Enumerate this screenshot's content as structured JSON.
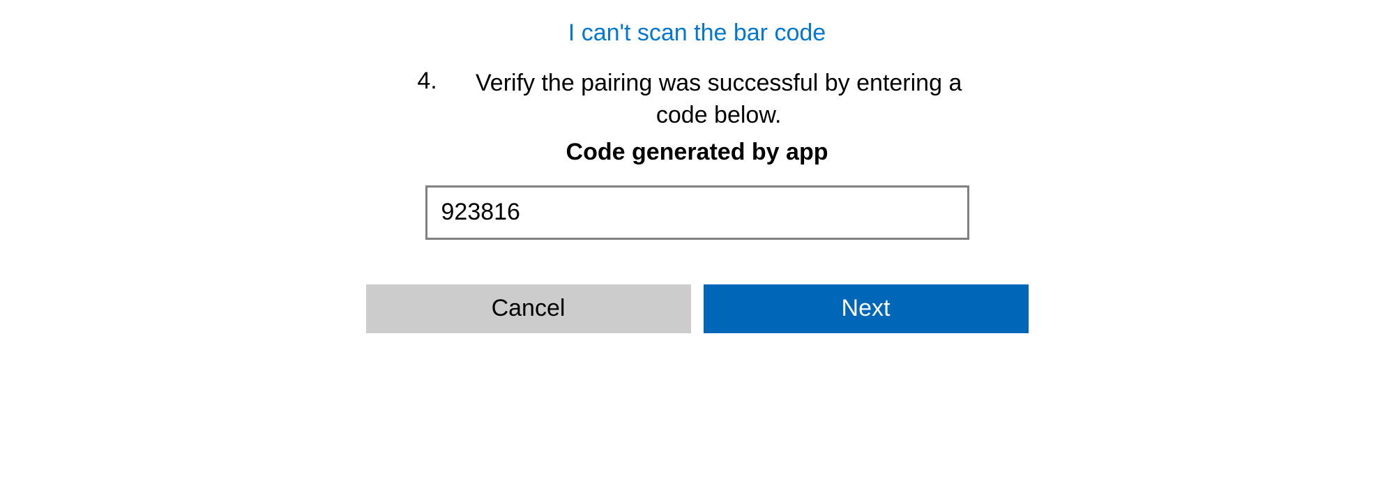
{
  "link_text": "I can't scan the bar code",
  "step": {
    "number": "4.",
    "text": "Verify the pairing was successful by entering a code below."
  },
  "code_label": "Code generated by app",
  "code_input_value": "923816",
  "buttons": {
    "cancel": "Cancel",
    "next": "Next"
  }
}
